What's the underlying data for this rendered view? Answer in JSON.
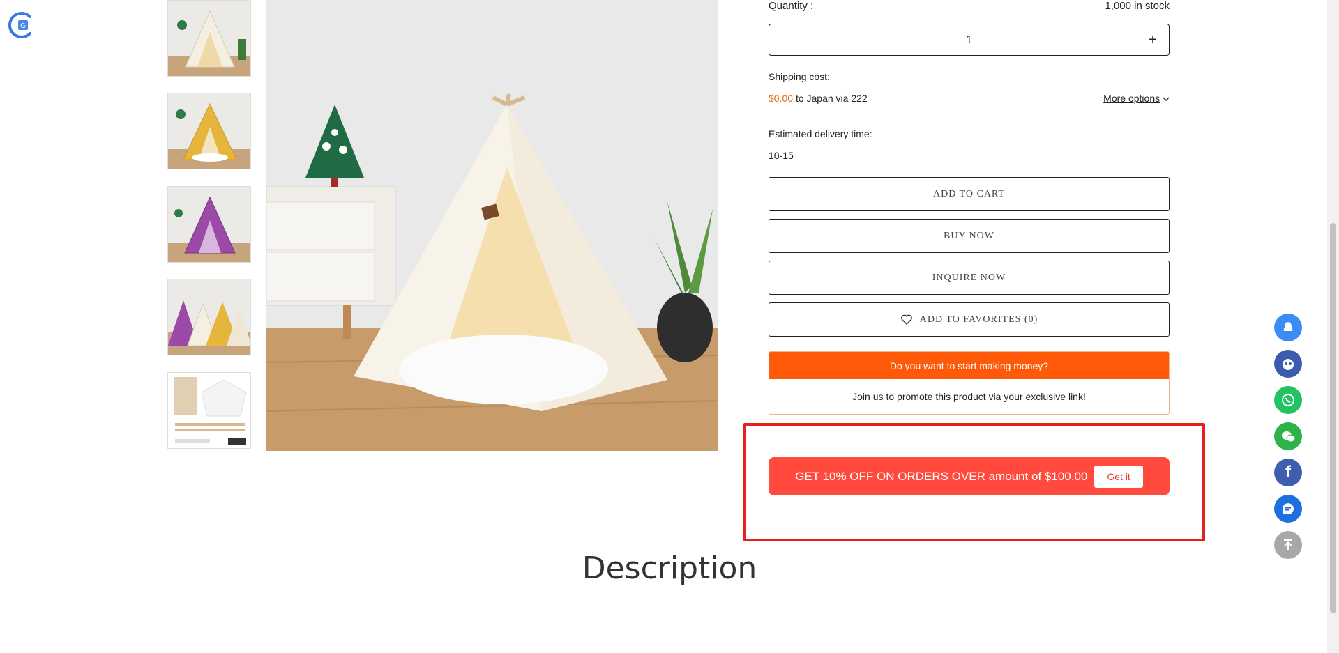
{
  "thumbnails": [
    {
      "name": "thumb-cream-tent",
      "color": "#f3ece0"
    },
    {
      "name": "thumb-yellow-tent",
      "color": "#e6b53c"
    },
    {
      "name": "thumb-purple-tent",
      "color": "#9b4aa8"
    },
    {
      "name": "thumb-group-tents",
      "color": "#d9d4cf"
    },
    {
      "name": "thumb-parts",
      "color": "#e8dcc8"
    }
  ],
  "product": {
    "quantity_label": "Quantity :",
    "stock": "1,000 in stock",
    "quantity": "1",
    "shipping_label": "Shipping cost:",
    "shipping_price": "$0.00",
    "shipping_dest": "to Japan via 222",
    "more_options": "More options",
    "delivery_label": "Estimated delivery time:",
    "delivery_value": "10-15"
  },
  "buttons": {
    "add_to_cart": "ADD TO CART",
    "buy_now": "BUY NOW",
    "inquire_now": "INQUIRE NOW",
    "add_to_favorites": "ADD TO FAVORITES (0)"
  },
  "affiliate": {
    "headline": "Do you want to start making money?",
    "join_link": "Join us",
    "text": "to promote this product via your exclusive link!"
  },
  "coupon": {
    "text": "GET 10% OFF ON ORDERS OVER amount of $100.00",
    "button": "Get it"
  },
  "section": {
    "description_heading": "Description"
  },
  "colors": {
    "accent_orange": "#ff5a0a",
    "price_orange": "#e8650c",
    "coupon_red": "#ff4a3d",
    "highlight_red": "#e62020"
  },
  "sidebar_icons": [
    "qq-icon",
    "service-bot-icon",
    "whatsapp-icon",
    "wechat-icon",
    "facebook-icon",
    "chat-icon",
    "back-to-top-icon"
  ]
}
